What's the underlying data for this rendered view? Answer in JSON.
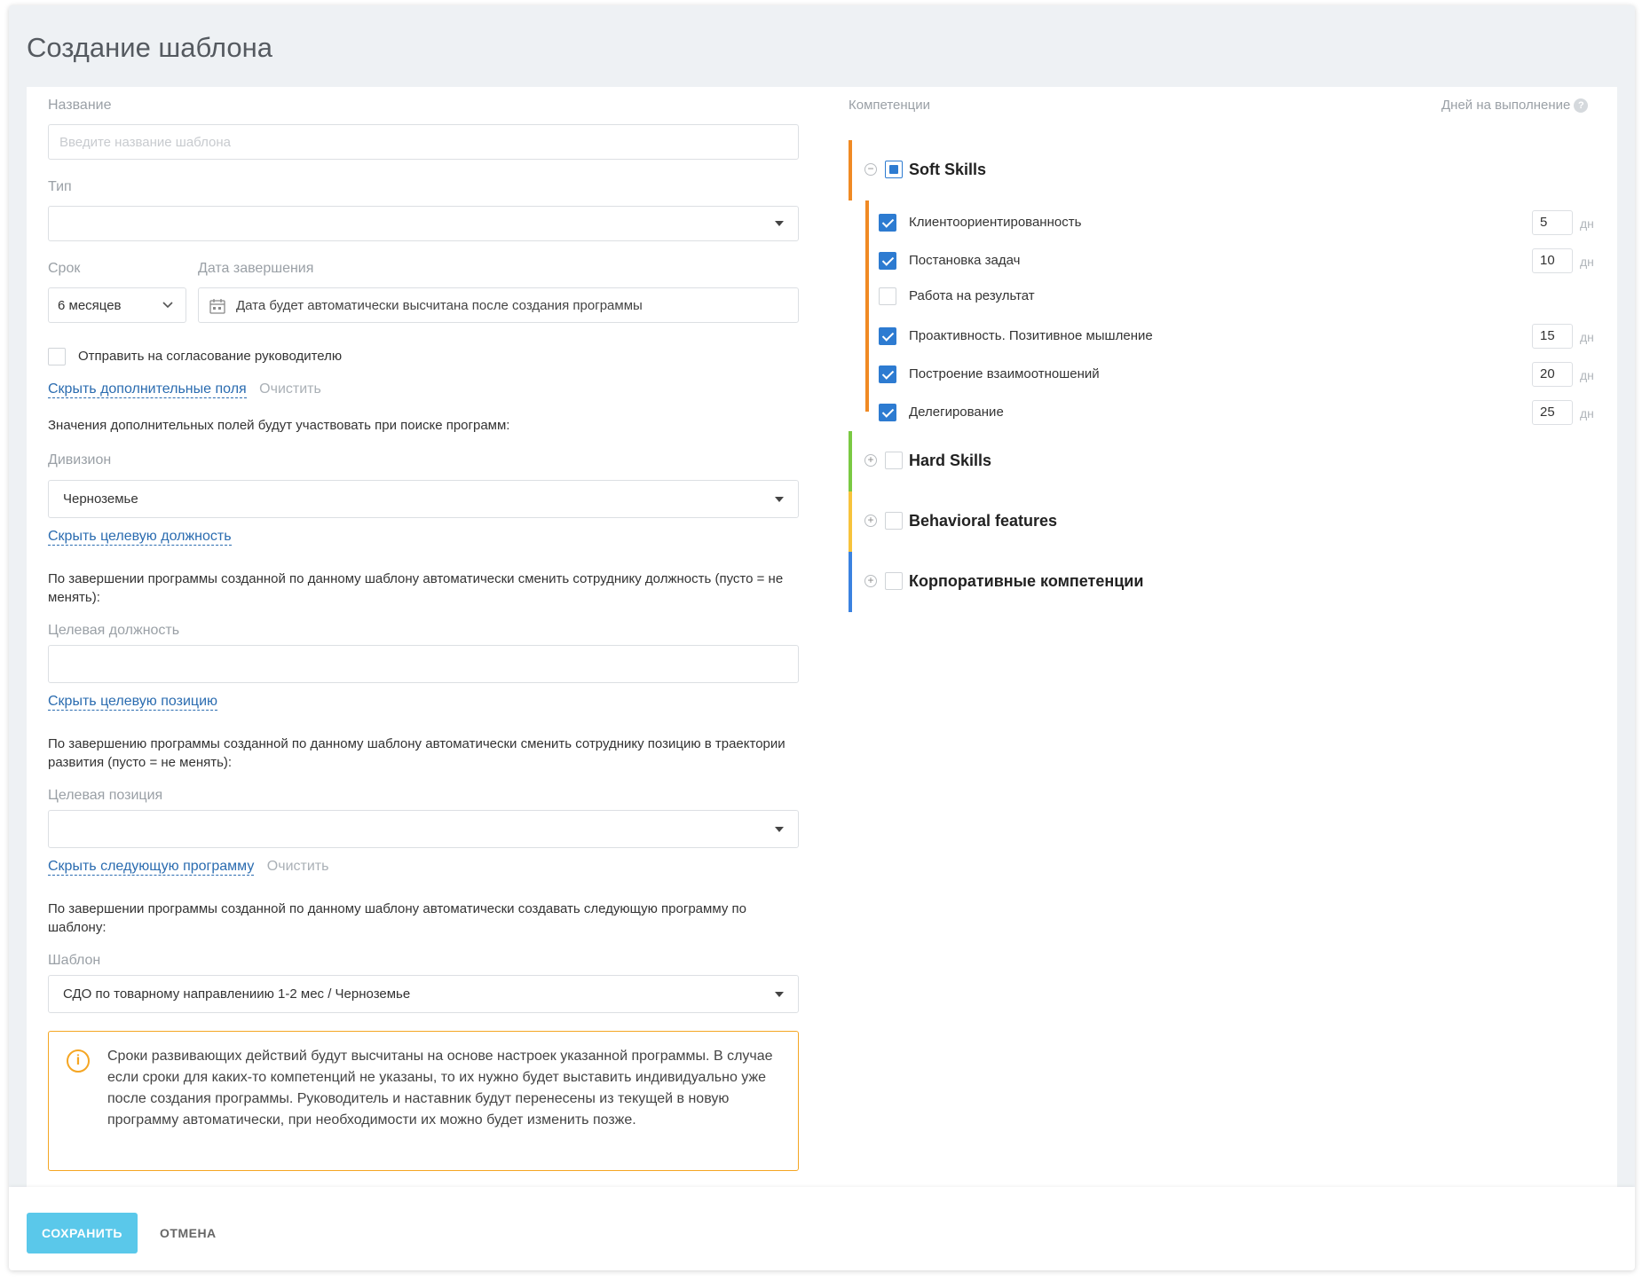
{
  "page": {
    "title": "Создание шаблона"
  },
  "form": {
    "name_label": "Название",
    "name_placeholder": "Введите название шаблона",
    "type_label": "Тип",
    "type_value": "",
    "term_label": "Срок",
    "term_value": "6 месяцев",
    "end_date_label": "Дата завершения",
    "end_date_value": "Дата будет автоматически высчитана после создания программы",
    "approve_checkbox_label": "Отправить на согласование руководителю",
    "approve_checked": false,
    "hide_extra_fields_link": "Скрыть дополнительные поля",
    "clear_link_1": "Очистить",
    "extra_fields_info": "Значения дополнительных полей будут участвовать при поиске программ:",
    "division_label": "Дивизион",
    "division_value": "Черноземье",
    "hide_target_role_link": "Скрыть целевую должность",
    "target_role_info": "По завершении программы созданной по данному шаблону автоматически сменить сотруднику должность (пусто = не менять):",
    "target_role_label": "Целевая должность",
    "target_role_value": "",
    "hide_target_position_link": "Скрыть целевую позицию",
    "target_position_info": "По завершению программы созданной по данному шаблону автоматически сменить сотруднику позицию в траектории развития (пусто = не менять):",
    "target_position_label": "Целевая позиция",
    "target_position_value": "",
    "hide_next_program_link": "Скрыть следующую программу",
    "clear_link_2": "Очистить",
    "next_program_info": "По завершении программы созданной по данному шаблону автоматически создавать следующую программу по шаблону:",
    "template_label": "Шаблон",
    "template_value": "СДО по товарному направлениию 1-2 мес / Черноземье",
    "notice_text": "Сроки развивающих действий будут высчитаны на основе настроек указанной программы. В случае если сроки для каких-то компетенций не указаны, то их нужно будет выставить индивидуально уже после создания программы. Руководитель и наставник будут перенесены из текущей в новую программу автоматически, при необходимости их можно будет изменить позже."
  },
  "competencies": {
    "header_label": "Компетенции",
    "days_header_label": "Дней на выполнение",
    "day_unit": "дн",
    "groups": [
      {
        "title": "Soft Skills",
        "color": "#f08a24",
        "state": "partial",
        "expanded": true,
        "items": [
          {
            "label": "Клиентоориентированность",
            "checked": true,
            "days": "5"
          },
          {
            "label": "Постановка задач",
            "checked": true,
            "days": "10"
          },
          {
            "label": "Работа на результат",
            "checked": false,
            "days": ""
          },
          {
            "label": "Проактивность. Позитивное мышление",
            "checked": true,
            "days": "15"
          },
          {
            "label": "Построение взаимоотношений",
            "checked": true,
            "days": "20"
          },
          {
            "label": "Делегирование",
            "checked": true,
            "days": "25"
          }
        ]
      },
      {
        "title": "Hard Skills",
        "color": "#7ac943",
        "state": "unchecked",
        "expanded": false,
        "items": []
      },
      {
        "title": "Behavioral features",
        "color": "#f7c33c",
        "state": "unchecked",
        "expanded": false,
        "items": []
      },
      {
        "title": "Корпоративные компетенции",
        "color": "#3b82e0",
        "state": "unchecked",
        "expanded": false,
        "items": []
      }
    ]
  },
  "footer": {
    "save_label": "СОХРАНИТЬ",
    "cancel_label": "ОТМЕНА"
  },
  "colors": {
    "accent": "#5ac8ea",
    "link": "#2b6cb0",
    "checkbox": "#2d7bd1",
    "warning": "#f5a623"
  }
}
